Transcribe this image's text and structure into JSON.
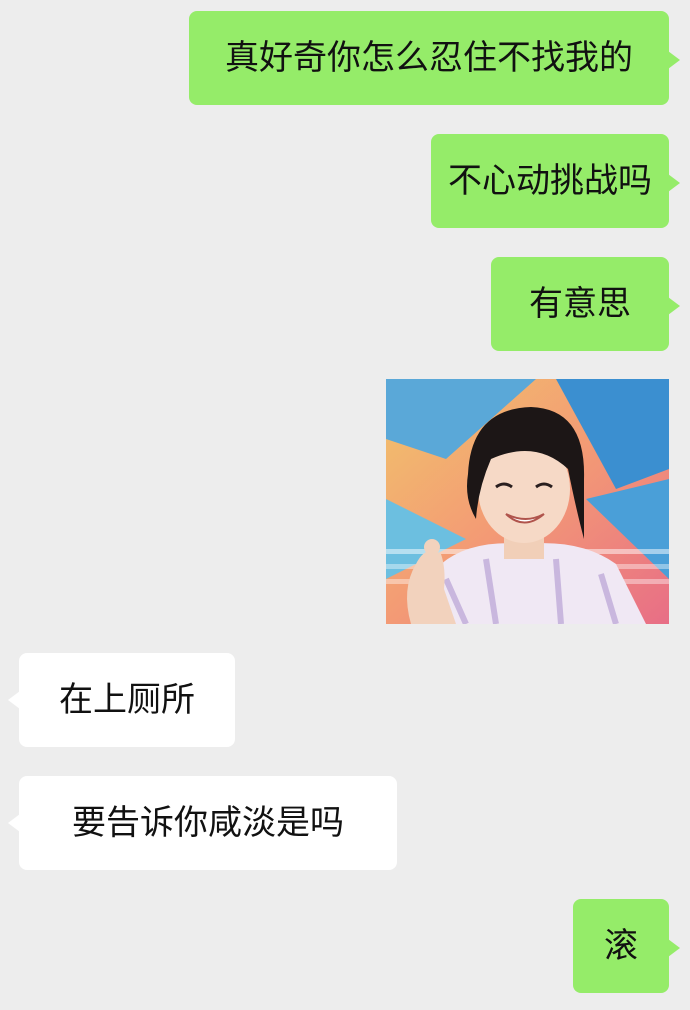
{
  "chat": {
    "messages": [
      {
        "side": "out",
        "text": "真好奇你怎么忍住不找我的"
      },
      {
        "side": "out",
        "text": "不心动挑战吗"
      },
      {
        "side": "out",
        "text": "有意思"
      },
      {
        "side": "out",
        "type": "sticker",
        "description": "laughing-woman-sticker"
      },
      {
        "side": "in",
        "text": "在上厕所"
      },
      {
        "side": "in",
        "text": "要告诉你咸淡是吗"
      },
      {
        "side": "out",
        "text": "滚"
      }
    ]
  },
  "colors": {
    "background": "#ededed",
    "outgoing_bubble": "#95ec69",
    "incoming_bubble": "#ffffff",
    "text": "#111111"
  }
}
